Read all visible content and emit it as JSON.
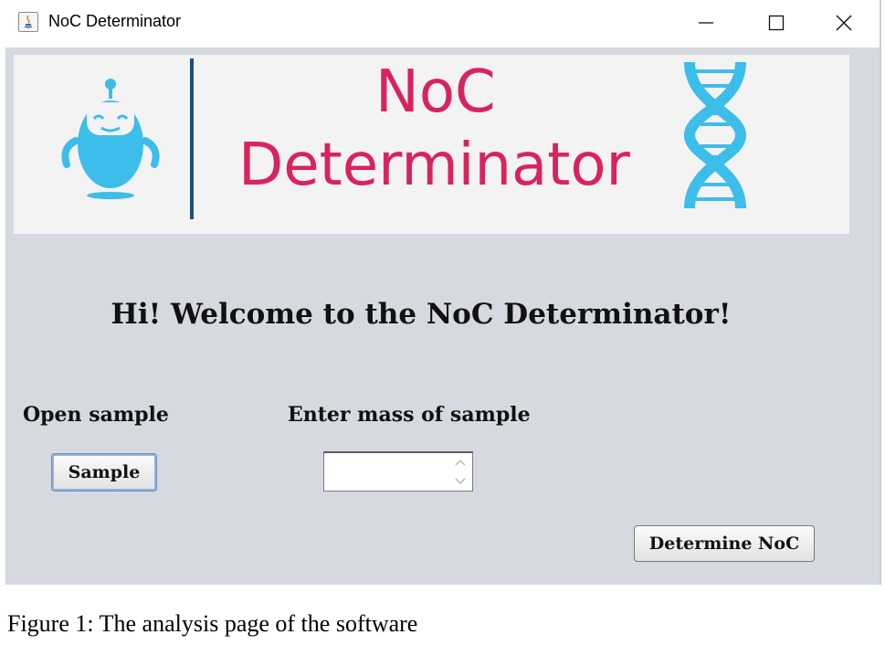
{
  "window": {
    "title": "NoC Determinator",
    "icon": "java-app-icon",
    "controls": [
      "minimize-icon",
      "maximize-icon",
      "close-icon"
    ]
  },
  "banner": {
    "title_line1": "NoC",
    "title_line2": "Determinator",
    "logo_left": "robot-icon",
    "logo_right": "dna-helix-icon",
    "colors": {
      "title": "#d8245b",
      "accent": "#3dbde9",
      "divider": "#1f4f7a"
    }
  },
  "main": {
    "welcome": "Hi! Welcome to the NoC Determinator!",
    "open_sample_label": "Open sample",
    "sample_button": "Sample",
    "mass_label": "Enter mass of sample",
    "mass_value": "",
    "determine_button": "Determine NoC"
  },
  "caption": "Figure 1: The analysis page of the software"
}
